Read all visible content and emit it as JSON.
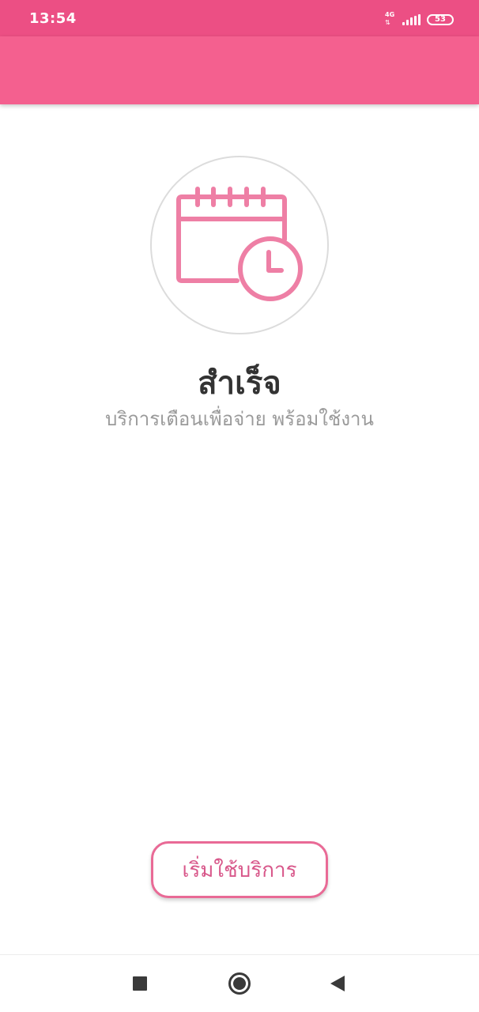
{
  "status_bar": {
    "time": "13:54",
    "network": "4G",
    "network_arrows": "⇅",
    "battery": "53",
    "background_color": "#ec4f84"
  },
  "app_bar": {
    "background_color": "#f4608f"
  },
  "hero": {
    "icon": "calendar-clock-icon",
    "icon_color": "#ee7fa5"
  },
  "content": {
    "title": "สำเร็จ",
    "subtitle": "บริการเตือนเพื่อจ่าย พร้อมใช้งาน"
  },
  "actions": {
    "start_label": "เริ่มใช้บริการ",
    "accent_color": "#e96a96"
  },
  "nav_bar": {
    "recent_icon": "square-recent-apps-icon",
    "home_icon": "circle-home-icon",
    "back_icon": "triangle-back-icon"
  }
}
